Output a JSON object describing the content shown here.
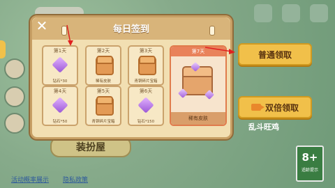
{
  "modal": {
    "title": "每日签到",
    "close_icon": "close-icon",
    "days": [
      {
        "label": "第1天",
        "item": "钻石*30",
        "icon": "gem-icon"
      },
      {
        "label": "第2天",
        "item": "稀有皮肤",
        "icon": "chest-icon"
      },
      {
        "label": "第3天",
        "item": "青铜碎片宝箱",
        "icon": "chest-icon"
      },
      {
        "label": "第4天",
        "item": "钻石*50",
        "icon": "gem-icon"
      },
      {
        "label": "第5天",
        "item": "青铜碎片宝箱",
        "icon": "chest-icon"
      },
      {
        "label": "第6天",
        "item": "钻石*150",
        "icon": "gem-icon"
      }
    ],
    "day7": {
      "label": "第7天",
      "item": "稀有皮肤"
    }
  },
  "actions": {
    "normal_claim": "普通领取",
    "double_claim": "双倍领取"
  },
  "background": {
    "dress_up": "装扮屋",
    "fight_label": "乱斗旺鸡",
    "footer_link_1": "活动概率展示",
    "footer_link_2": "隐私政策",
    "age_rating": "8+",
    "age_note": "适龄提示"
  },
  "colors": {
    "accent": "#f1c04a",
    "day7_border": "#e07b4c",
    "arrow": "#e02020"
  }
}
